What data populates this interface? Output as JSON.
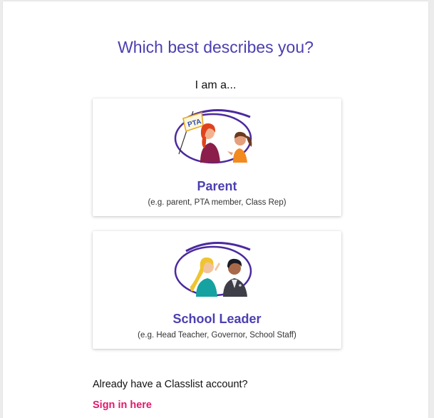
{
  "heading": "Which best describes you?",
  "prompt": "I am a...",
  "options": [
    {
      "title": "Parent",
      "description": "(e.g. parent, PTA member, Class Rep)",
      "illustration": "parent-pta-illustration",
      "flag_text": "PTA"
    },
    {
      "title": "School Leader",
      "description": "(e.g. Head Teacher, Governor, School Staff)",
      "illustration": "school-leader-illustration"
    }
  ],
  "account": {
    "question": "Already have a Classlist account?",
    "signin_label": "Sign in here"
  },
  "colors": {
    "accent": "#4b3fb0",
    "link": "#e0186c",
    "background": "#ffffff"
  }
}
